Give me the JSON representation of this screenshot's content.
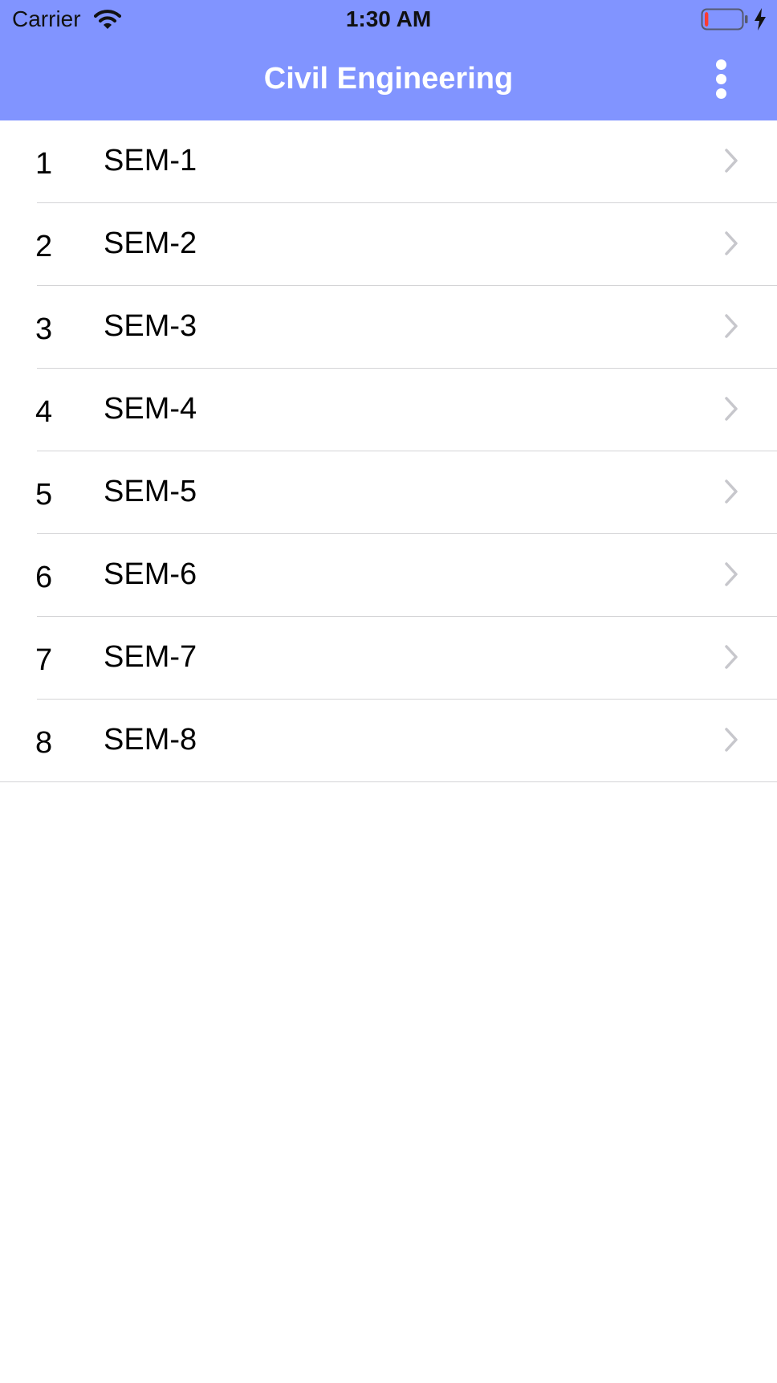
{
  "status_bar": {
    "carrier": "Carrier",
    "time": "1:30 AM"
  },
  "nav": {
    "title": "Civil Engineering"
  },
  "semesters": [
    {
      "num": "1",
      "label": "SEM-1"
    },
    {
      "num": "2",
      "label": "SEM-2"
    },
    {
      "num": "3",
      "label": "SEM-3"
    },
    {
      "num": "4",
      "label": "SEM-4"
    },
    {
      "num": "5",
      "label": "SEM-5"
    },
    {
      "num": "6",
      "label": "SEM-6"
    },
    {
      "num": "7",
      "label": "SEM-7"
    },
    {
      "num": "8",
      "label": "SEM-8"
    }
  ],
  "icons": {
    "wifi": "wifi-icon",
    "battery": "battery-icon",
    "charging": "charging-bolt-icon",
    "more": "more-vertical-icon",
    "chevron": "chevron-right-icon"
  },
  "colors": {
    "header_bg": "#8194ff",
    "battery_level": "#ff3b30",
    "chevron": "#c7c7cc",
    "separator": "#d4d4d6"
  },
  "battery_level": 0.1
}
